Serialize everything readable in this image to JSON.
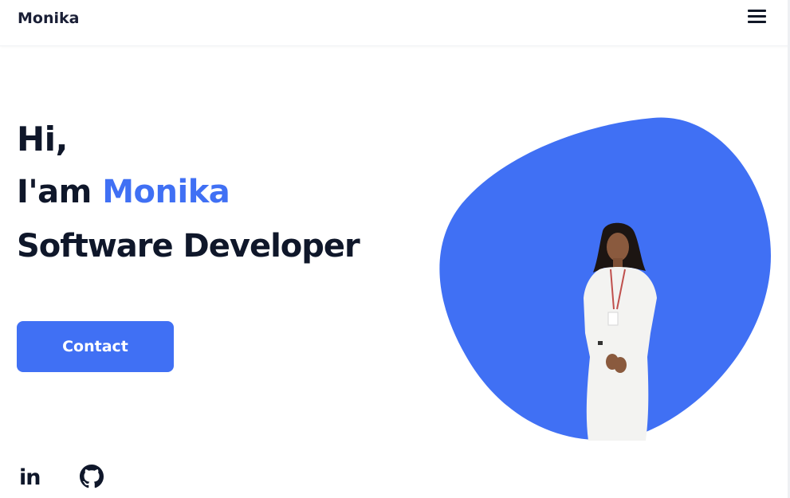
{
  "header": {
    "logo": "Monika",
    "menu_icon": "hamburger-menu-icon"
  },
  "hero": {
    "greeting": "Hi,",
    "intro_prefix": "I'am ",
    "name": "Monika",
    "role": "Software Developer",
    "contact_label": "Contact"
  },
  "social": {
    "linkedin_text": "in",
    "linkedin_icon": "linkedin-icon",
    "github_icon": "github-icon"
  },
  "colors": {
    "accent": "#4070f4",
    "text": "#0f172a",
    "background": "#ffffff"
  },
  "hero_image": {
    "shape": "blob",
    "subject": "person-photo"
  }
}
